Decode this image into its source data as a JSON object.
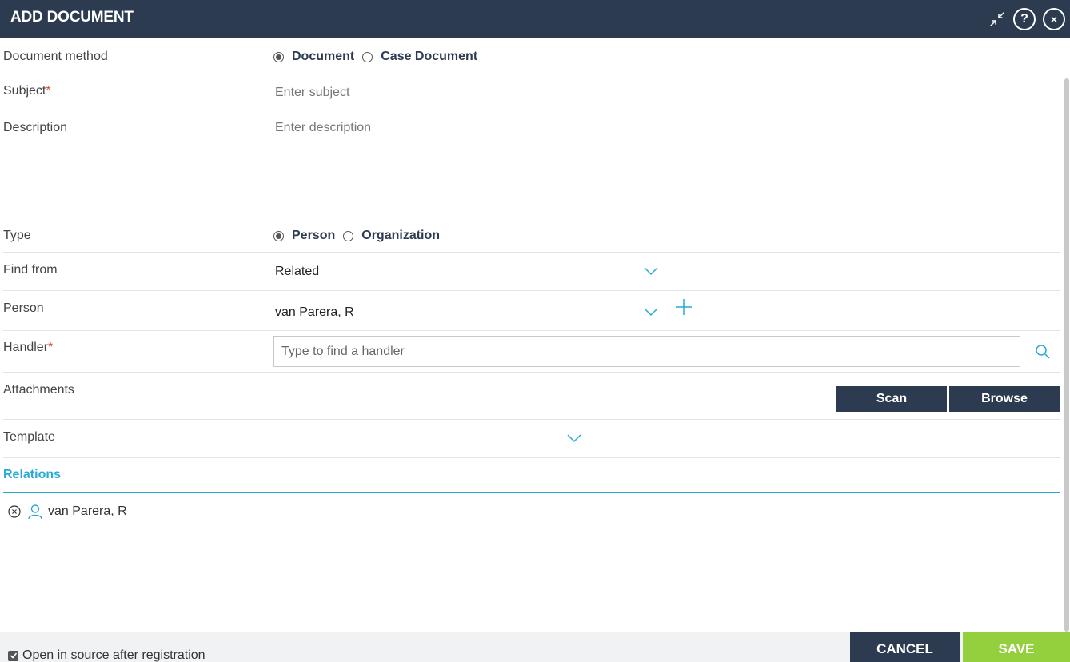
{
  "dialog": {
    "title": "ADD DOCUMENT",
    "icons": [
      "minimize-icon",
      "help-icon",
      "close-icon"
    ],
    "help_glyph": "?",
    "close_glyph": "×"
  },
  "form": {
    "document_method": {
      "label": "Document method",
      "options": [
        "Document",
        "Case Document"
      ],
      "selected": "Document"
    },
    "subject": {
      "label": "Subject",
      "required_mark": "*",
      "placeholder": "Enter subject"
    },
    "description": {
      "label": "Description",
      "placeholder": "Enter description"
    },
    "type": {
      "label": "Type",
      "options": [
        "Person",
        "Organization"
      ],
      "selected": "Person"
    },
    "find_from": {
      "label": "Find from",
      "value": "Related"
    },
    "person": {
      "label": "Person",
      "value": "van Parera, R"
    },
    "handler": {
      "label": "Handler",
      "required_mark": "*",
      "placeholder": "Type to find a handler"
    },
    "attachments": {
      "label": "Attachments",
      "scan_label": "Scan",
      "browse_label": "Browse"
    },
    "template": {
      "label": "Template",
      "value": ""
    }
  },
  "relations": {
    "title": "Relations",
    "items": [
      {
        "name": "van Parera, R",
        "icon": "person-icon"
      }
    ]
  },
  "footer": {
    "open_in_source_label": "Open in source after registration",
    "open_in_source_checked": true,
    "cancel_label": "CANCEL",
    "save_label": "SAVE"
  },
  "colors": {
    "header_bg": "#2d3b50",
    "accent": "#29a9d6",
    "save_green": "#94cf3e",
    "required": "#e34a3a"
  }
}
